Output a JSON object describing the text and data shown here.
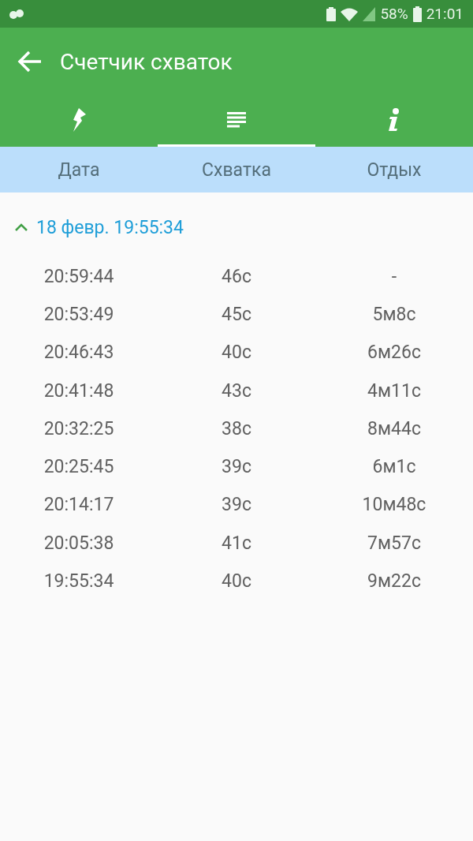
{
  "status_bar": {
    "battery": "58%",
    "time": "21:01"
  },
  "app_bar": {
    "title": "Счетчик схваток"
  },
  "tabs": [
    {
      "kind": "bolt",
      "selected": false
    },
    {
      "kind": "list",
      "selected": true
    },
    {
      "kind": "info",
      "selected": false
    }
  ],
  "table": {
    "columns": [
      "Дата",
      "Схватка",
      "Отдых"
    ],
    "groups": [
      {
        "title": "18 февр. 19:55:34",
        "expanded": true,
        "rows": [
          [
            "20:59:44",
            "46с",
            "-"
          ],
          [
            "20:53:49",
            "45с",
            "5м8с"
          ],
          [
            "20:46:43",
            "40с",
            "6м26с"
          ],
          [
            "20:41:48",
            "43с",
            "4м11с"
          ],
          [
            "20:32:25",
            "38с",
            "8м44с"
          ],
          [
            "20:25:45",
            "39с",
            "6м1с"
          ],
          [
            "20:14:17",
            "39с",
            "10м48с"
          ],
          [
            "20:05:38",
            "41с",
            "7м57с"
          ],
          [
            "19:55:34",
            "40с",
            "9м22с"
          ]
        ]
      }
    ]
  }
}
